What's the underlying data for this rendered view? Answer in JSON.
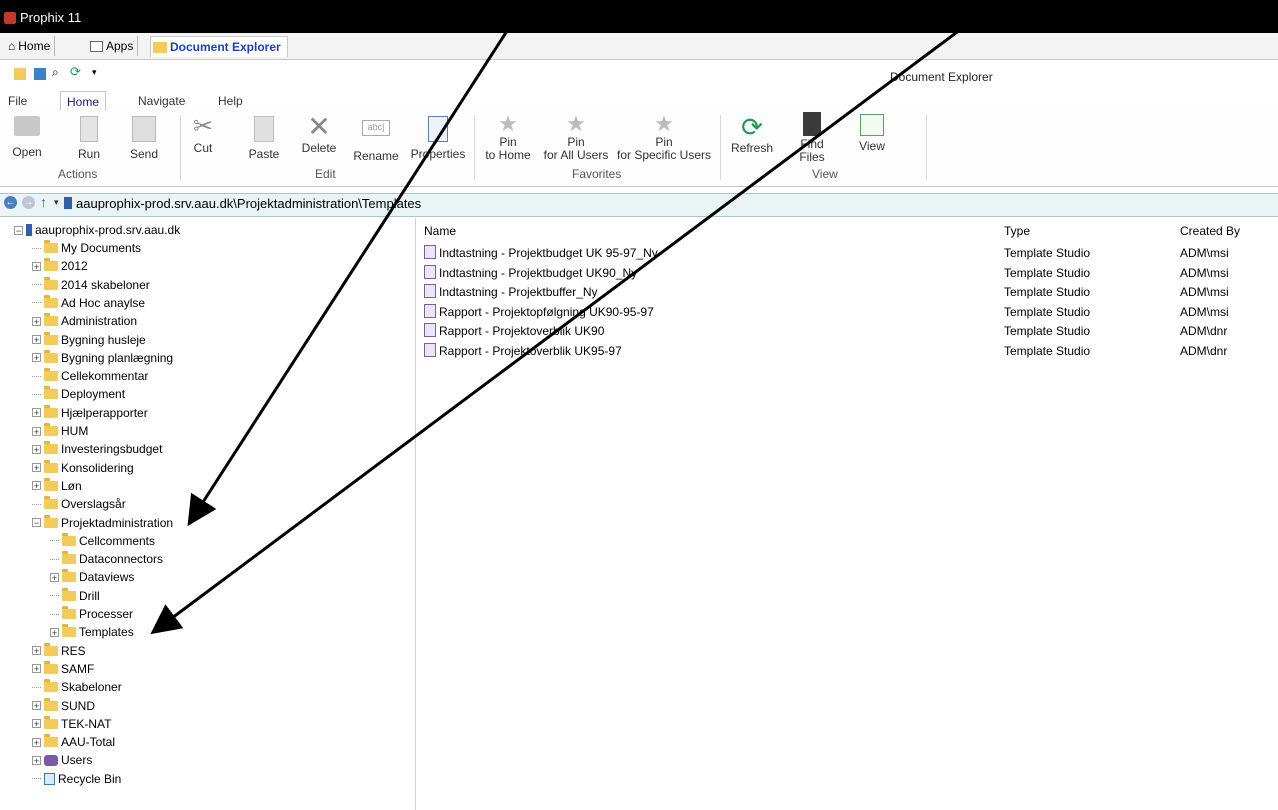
{
  "window": {
    "title": "Prophix 11"
  },
  "tabs": [
    {
      "label": "Home",
      "icon": "home-icon"
    },
    {
      "label": "Apps",
      "icon": "apps-icon"
    },
    {
      "label": "Document Explorer",
      "icon": "document-explorer-icon"
    }
  ],
  "document_title": "Document Explorer",
  "ribbon_tabs": [
    "File",
    "Home",
    "Navigate",
    "Help"
  ],
  "ribbon": {
    "open": "Open",
    "run": "Run",
    "send": "Send",
    "cut": "Cut",
    "paste": "Paste",
    "delete": "Delete",
    "rename": "Rename",
    "properties": "Properties",
    "pin_home_1": "Pin",
    "pin_home_2": "to Home",
    "pin_all_1": "Pin",
    "pin_all_2": "for All Users",
    "pin_specific_1": "Pin",
    "pin_specific_2": "for Specific Users",
    "refresh": "Refresh",
    "find_1": "Find",
    "find_2": "Files",
    "view": "View",
    "groups": {
      "actions": "Actions",
      "edit": "Edit",
      "favorites": "Favorites",
      "view": "View"
    }
  },
  "address": {
    "path": "aauprophix-prod.srv.aau.dk\\Projektadministration\\Templates"
  },
  "tree": {
    "root": "aauprophix-prod.srv.aau.dk",
    "items": [
      "My Documents",
      "2012",
      "2014 skabeloner",
      "Ad Hoc anaylse",
      "Administration",
      "Bygning husleje",
      "Bygning planlægning",
      "Cellekommentar",
      "Deployment",
      "Hjælperapporter",
      "HUM",
      "Investeringsbudget",
      "Konsolidering",
      "Løn",
      "Overslagsår",
      "Projektadministration",
      "Cellcomments",
      "Dataconnectors",
      "Dataviews",
      "Drill",
      "Processer",
      "Templates",
      "RES",
      "SAMF",
      "Skabeloner",
      "SUND",
      "TEK-NAT",
      "AAU-Total",
      "Users",
      "Recycle Bin"
    ]
  },
  "file_list": {
    "columns": {
      "name": "Name",
      "type": "Type",
      "created_by": "Created By"
    },
    "rows": [
      {
        "name": "Indtastning - Projektbudget UK 95-97_Ny",
        "type": "Template Studio",
        "created_by": "ADM\\msi"
      },
      {
        "name": "Indtastning - Projektbudget UK90_Ny",
        "type": "Template Studio",
        "created_by": "ADM\\msi"
      },
      {
        "name": "Indtastning - Projektbuffer_Ny",
        "type": "Template Studio",
        "created_by": "ADM\\msi"
      },
      {
        "name": "Rapport - Projektopfølgning UK90-95-97",
        "type": "Template Studio",
        "created_by": "ADM\\msi"
      },
      {
        "name": "Rapport - Projektoverblik UK90",
        "type": "Template Studio",
        "created_by": "ADM\\dnr"
      },
      {
        "name": "Rapport - Projektoverblik UK95-97",
        "type": "Template Studio",
        "created_by": "ADM\\dnr"
      }
    ]
  },
  "colors": {
    "accent": "#1a3fbf",
    "folder": "#f2cc5a",
    "address_bg": "#eaf4f5",
    "refresh_green": "#1f9a55"
  }
}
